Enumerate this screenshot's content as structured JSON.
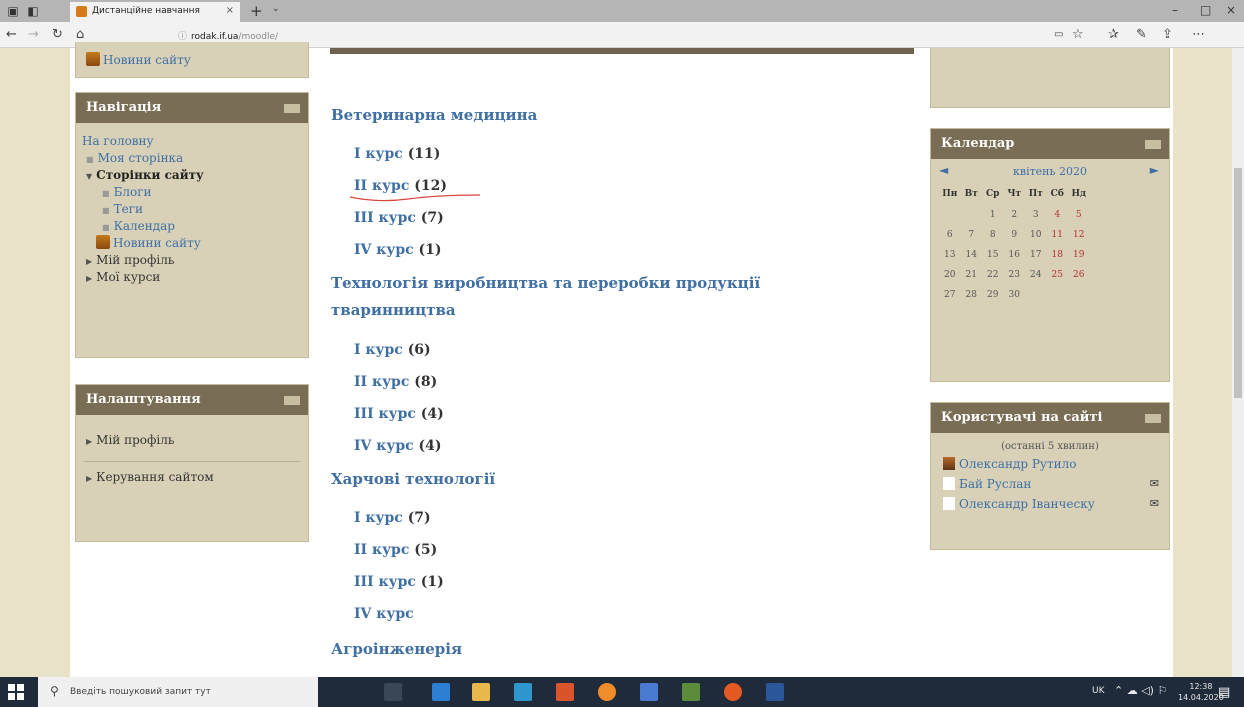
{
  "browser": {
    "tab_title": "Дистанційне навчання",
    "tab_close": "×",
    "new_tab": "+",
    "tab_dropdown": "⌄",
    "url_host": "rodak.if.ua",
    "url_path": "/moodle/",
    "min": "–",
    "max": "□",
    "close": "×"
  },
  "left": {
    "news_link": "Новини сайту",
    "navigation": {
      "title": "Навігація",
      "home": "На головну",
      "my_page": "Моя сторінка",
      "site_pages": "Сторінки сайту",
      "blogs": "Блоги",
      "tags": "Теги",
      "calendar": "Календар",
      "site_news": "Новини сайту",
      "my_profile": "Мій профіль",
      "my_courses": "Мої курси"
    },
    "settings": {
      "title": "Налаштування",
      "my_profile": "Мій профіль",
      "site_admin": "Керування сайтом"
    }
  },
  "main": {
    "categories": [
      {
        "name": "Ветеринарна медицина",
        "courses": [
          {
            "label": "I курс",
            "count": "(11)"
          },
          {
            "label": "II курс",
            "count": "(12)"
          },
          {
            "label": "III курс",
            "count": "(7)"
          },
          {
            "label": "IV курс",
            "count": "(1)"
          }
        ]
      },
      {
        "name_line1": "Технологія виробництва та переробки продукції",
        "name_line2": "тваринництва",
        "courses": [
          {
            "label": "I курс",
            "count": "(6)"
          },
          {
            "label": "II курс",
            "count": "(8)"
          },
          {
            "label": "III курс",
            "count": "(4)"
          },
          {
            "label": "IV курс",
            "count": "(4)"
          }
        ]
      },
      {
        "name": "Харчові технології",
        "courses": [
          {
            "label": "I курс",
            "count": "(7)"
          },
          {
            "label": "II курс",
            "count": "(5)"
          },
          {
            "label": "III курс",
            "count": "(1)"
          },
          {
            "label": "IV курс",
            "count": ""
          }
        ]
      },
      {
        "name": "Агроінженерія"
      }
    ]
  },
  "right": {
    "calendar": {
      "title": "Календар",
      "month": "квітень 2020",
      "prev": "◄",
      "next": "►",
      "weekdays": [
        "Пн",
        "Вт",
        "Ср",
        "Чт",
        "Пт",
        "Сб",
        "Нд"
      ],
      "weeks": [
        [
          "",
          "",
          "1",
          "2",
          "3",
          "4",
          "5"
        ],
        [
          "6",
          "7",
          "8",
          "9",
          "10",
          "11",
          "12"
        ],
        [
          "13",
          "14",
          "15",
          "16",
          "17",
          "18",
          "19"
        ],
        [
          "20",
          "21",
          "22",
          "23",
          "24",
          "25",
          "26"
        ],
        [
          "27",
          "28",
          "29",
          "30",
          "",
          "",
          ""
        ]
      ]
    },
    "users": {
      "title": "Користувачі на сайті",
      "subtitle": "(останні 5 хвилин)",
      "list": [
        {
          "name": "Олександр Рутило",
          "mail": ""
        },
        {
          "name": "Бай Руслан",
          "mail": "✉"
        },
        {
          "name": "Олександр Іванческу",
          "mail": "✉"
        }
      ]
    }
  },
  "taskbar": {
    "search_placeholder": "Введіть пошуковий запит тут",
    "lang": "UK",
    "time": "12:38",
    "date": "14.04.2020"
  }
}
